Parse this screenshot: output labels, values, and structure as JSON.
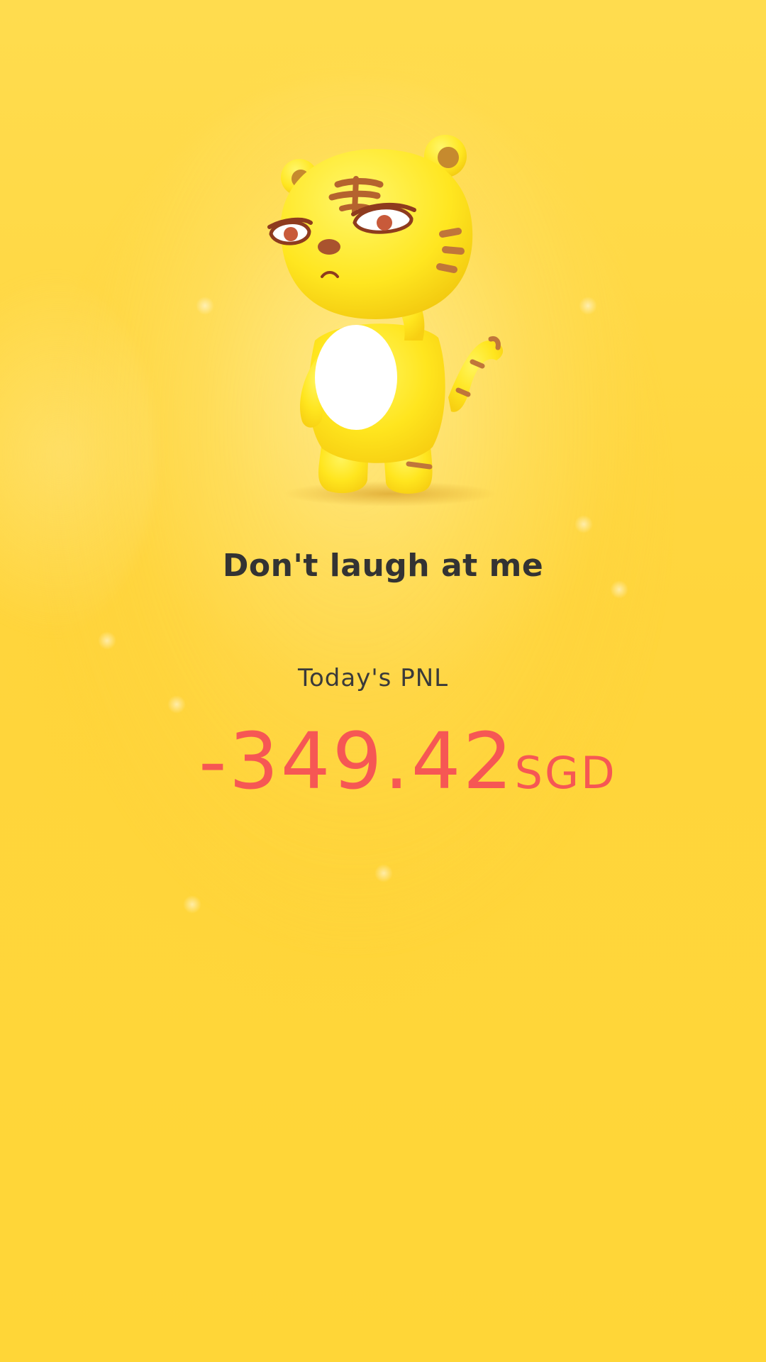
{
  "mascot": {
    "icon": "tiger-mascot-icon",
    "description_colors": {
      "body": "#FFE324",
      "belly": "#FFFFFF",
      "stripes": "#C0763A"
    }
  },
  "tagline": "Don't laugh at me",
  "pnl": {
    "label": "Today's PNL",
    "value": "-349.42",
    "currency": "SGD"
  },
  "colors": {
    "background": "#FFD83A",
    "loss": "#F65754",
    "text": "#333333"
  }
}
